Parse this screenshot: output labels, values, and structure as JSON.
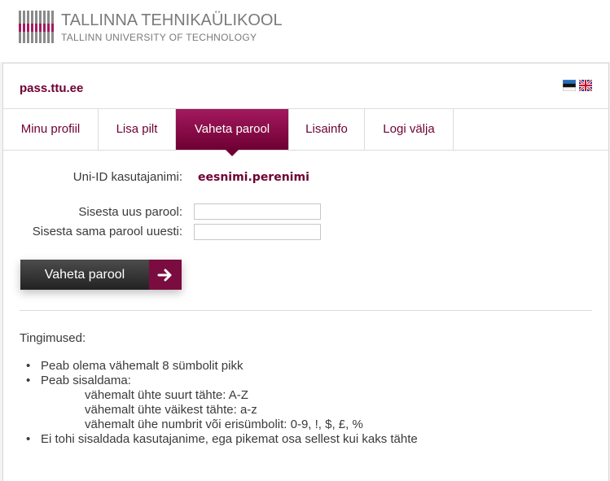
{
  "brand": {
    "name_et": "TALLINNA TEHNIKAÜLIKOOL",
    "name_en": "TALLINN UNIVERSITY OF TECHNOLOGY",
    "color": "#6e0033"
  },
  "site": {
    "title": "pass.ttu.ee",
    "languages": [
      {
        "code": "et",
        "icon": "estonian-flag-icon"
      },
      {
        "code": "en",
        "icon": "uk-flag-icon"
      }
    ]
  },
  "tabs": [
    {
      "label": "Minu profiil",
      "active": false
    },
    {
      "label": "Lisa pilt",
      "active": false
    },
    {
      "label": "Vaheta parool",
      "active": true
    },
    {
      "label": "Lisainfo",
      "active": false
    },
    {
      "label": "Logi välja",
      "active": false
    }
  ],
  "form": {
    "username_label": "Uni-ID kasutajanimi:",
    "username_value": "eesnimi.perenimi",
    "new_password_label": "Sisesta uus parool:",
    "new_password_value": "",
    "repeat_password_label": "Sisesta sama parool uuesti:",
    "repeat_password_value": "",
    "submit_label": "Vaheta parool",
    "submit_icon": "arrow-right-icon"
  },
  "conditions": {
    "title": "Tingimused:",
    "rule1": "Peab olema vähemalt 8 sümbolit pikk",
    "rule2": "Peab sisaldama:",
    "rule2_sub": [
      "vähemalt ühte suurt tähte: A-Z",
      "vähemalt ühte väikest tähte: a-z",
      "vähemalt ühe numbrit või erisümbolit: 0-9, !, $, £, %"
    ],
    "rule3": "Ei tohi sisaldada kasutajanime, ega pikemat osa sellest kui kaks tähte",
    "bullet": "•"
  }
}
